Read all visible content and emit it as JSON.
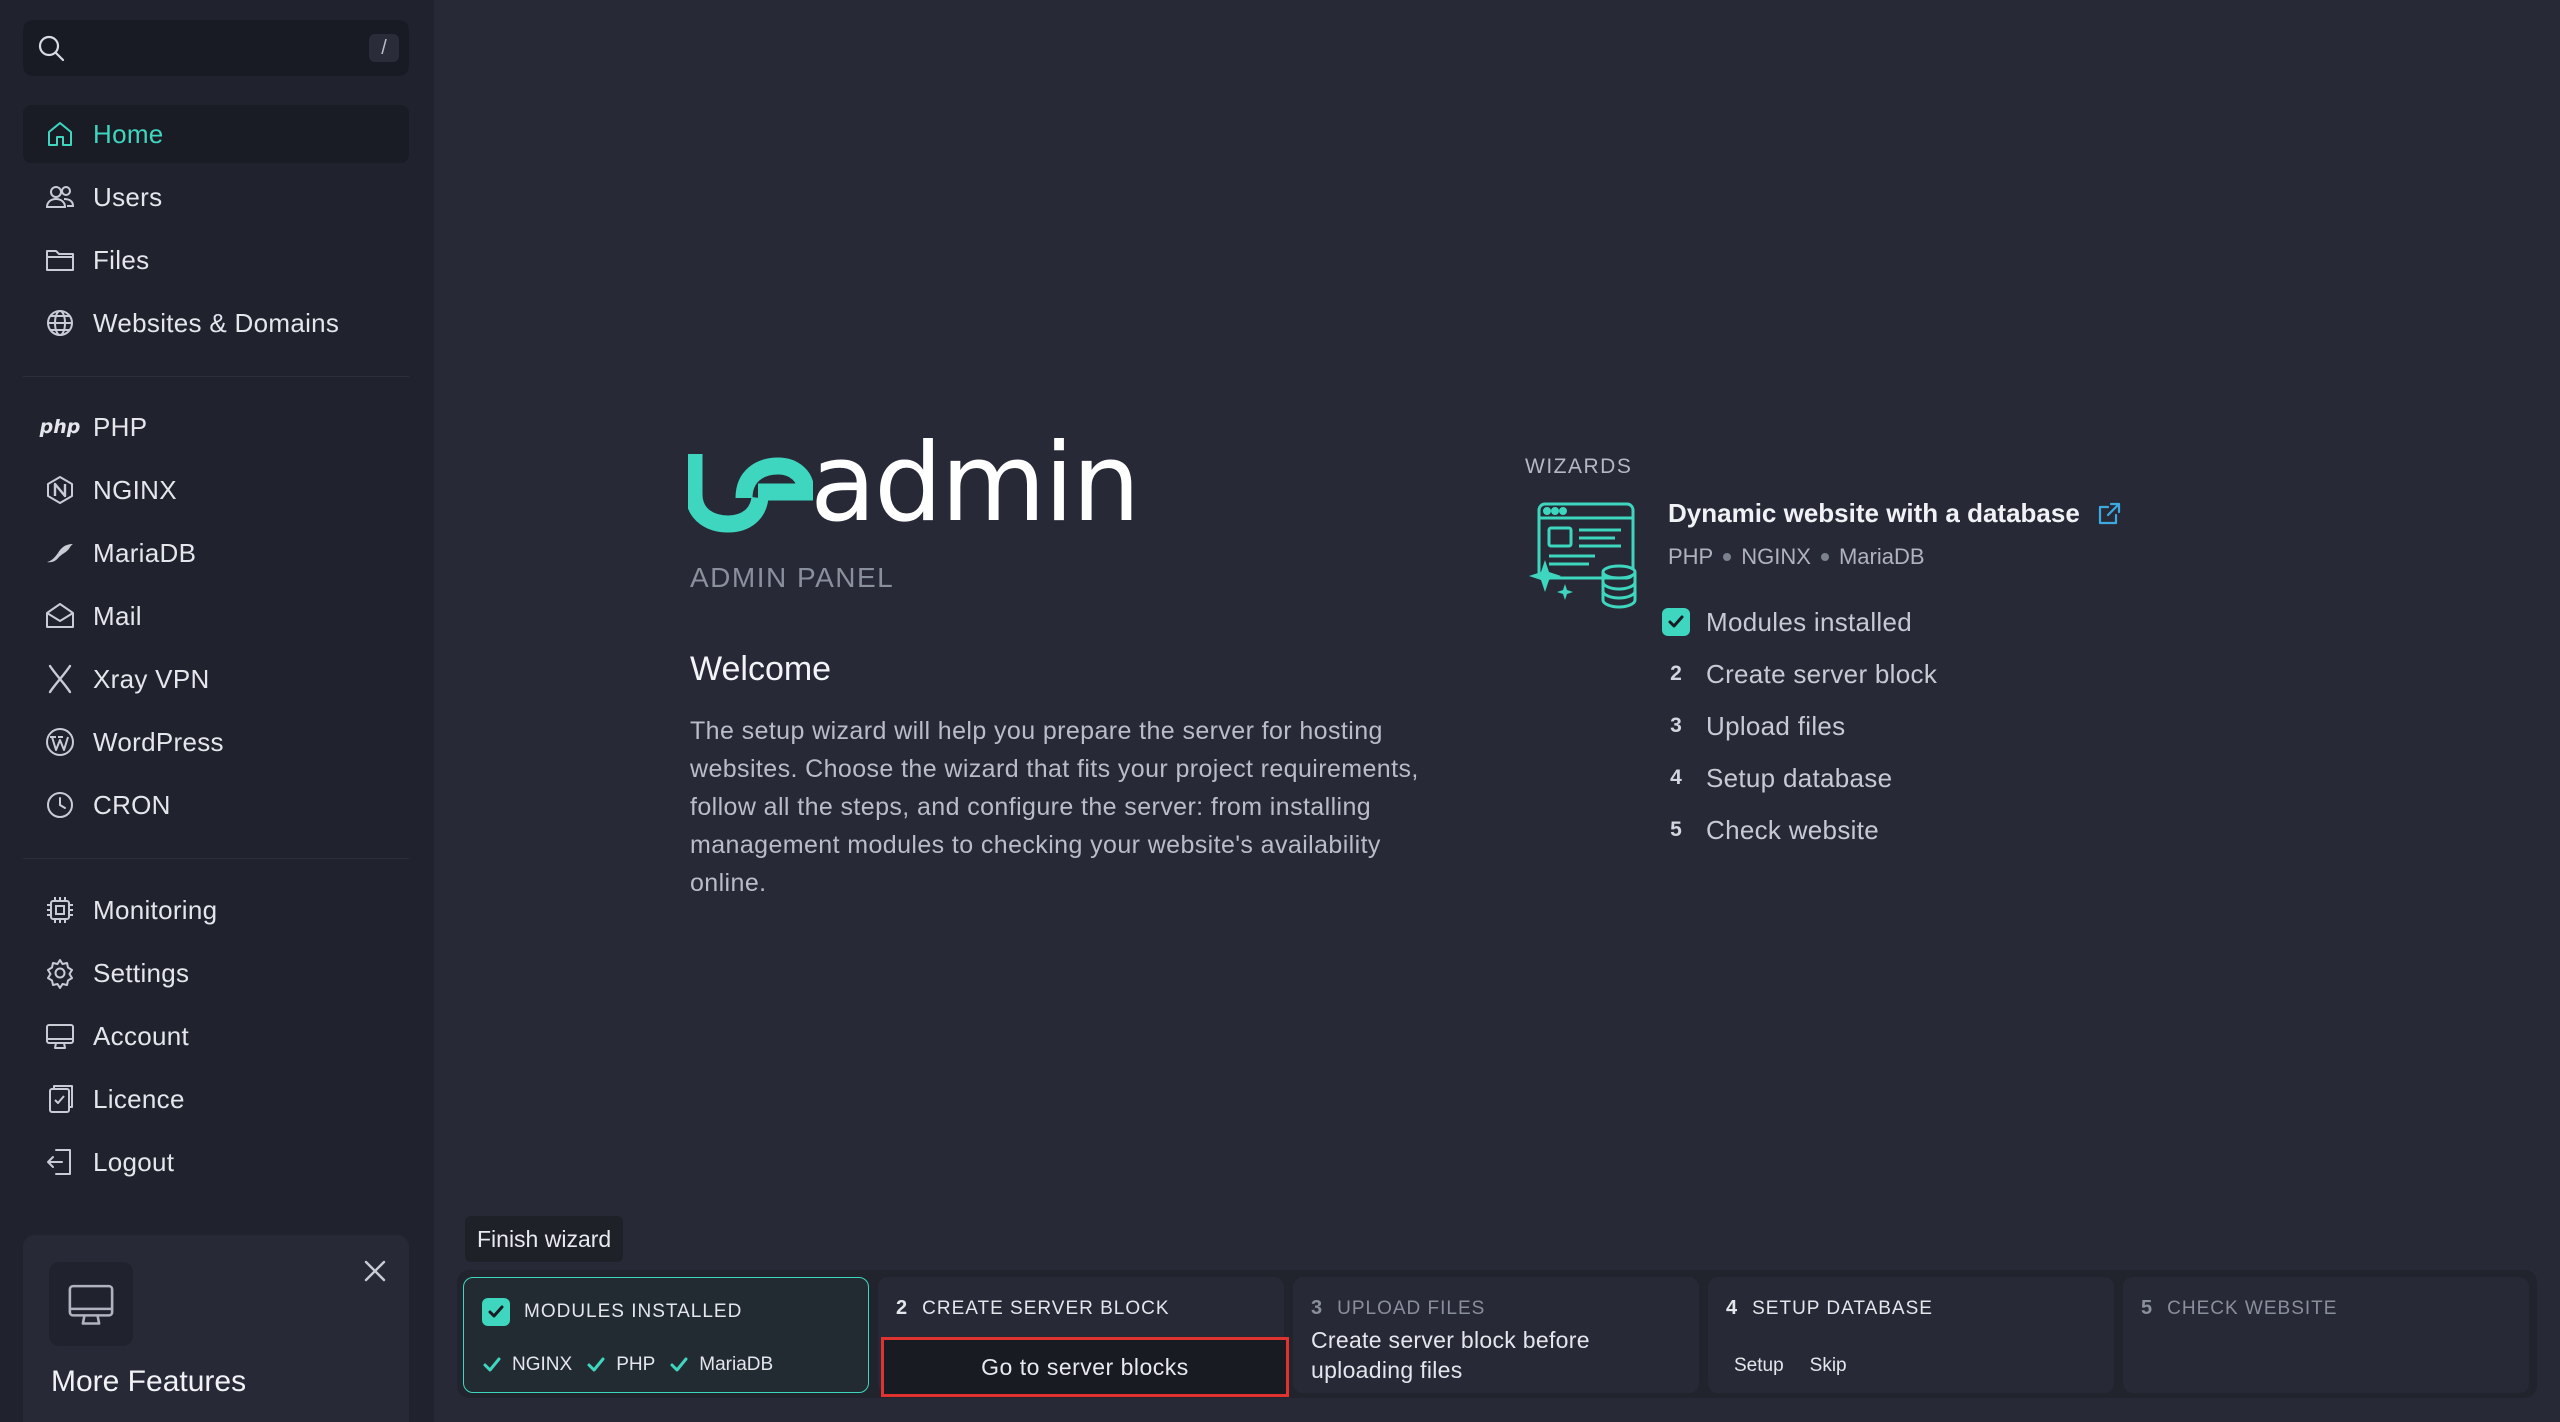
{
  "search": {
    "shortcut": "/"
  },
  "sidebar": {
    "groups": [
      [
        {
          "label": "Home",
          "icon": "home-icon",
          "active": true
        },
        {
          "label": "Users",
          "icon": "users-icon"
        },
        {
          "label": "Files",
          "icon": "folder-icon"
        },
        {
          "label": "Websites & Domains",
          "icon": "globe-icon"
        }
      ],
      [
        {
          "label": "PHP",
          "icon": "php-icon",
          "icon_text": "php"
        },
        {
          "label": "NGINX",
          "icon": "nginx-icon"
        },
        {
          "label": "MariaDB",
          "icon": "mariadb-icon"
        },
        {
          "label": "Mail",
          "icon": "mail-icon"
        },
        {
          "label": "Xray VPN",
          "icon": "xray-icon"
        },
        {
          "label": "WordPress",
          "icon": "wordpress-icon"
        },
        {
          "label": "CRON",
          "icon": "clock-icon"
        }
      ],
      [
        {
          "label": "Monitoring",
          "icon": "cpu-icon"
        },
        {
          "label": "Settings",
          "icon": "gear-icon"
        },
        {
          "label": "Account",
          "icon": "monitor-icon"
        },
        {
          "label": "Licence",
          "icon": "licence-icon"
        },
        {
          "label": "Logout",
          "icon": "logout-icon"
        }
      ]
    ],
    "promo": {
      "title": "More Features",
      "icon": "monitor-icon"
    }
  },
  "brand": {
    "logo_text": "beadmin",
    "subtitle": "ADMIN PANEL",
    "accent": "#3ed6bf"
  },
  "welcome": {
    "title": "Welcome",
    "text": "The setup wizard will help you prepare the server for hosting websites. Choose the wizard that fits your project requirements, follow all the steps, and configure the server: from installing management modules to checking your website's availability online."
  },
  "wizards": {
    "label": "WIZARDS",
    "title": "Dynamic website with a database",
    "stack": [
      "PHP",
      "NGINX",
      "MariaDB"
    ],
    "steps": [
      {
        "num": "",
        "label": "Modules installed",
        "done": true
      },
      {
        "num": "2",
        "label": "Create server block"
      },
      {
        "num": "3",
        "label": "Upload files"
      },
      {
        "num": "4",
        "label": "Setup database"
      },
      {
        "num": "5",
        "label": "Check website"
      }
    ]
  },
  "wizard_bar": {
    "finish_label": "Finish wizard",
    "cards": [
      {
        "num": "",
        "title": "MODULES INSTALLED",
        "modules": [
          "NGINX",
          "PHP",
          "MariaDB"
        ]
      },
      {
        "num": "2",
        "title": "CREATE SERVER BLOCK",
        "button": "Go to server blocks"
      },
      {
        "num": "3",
        "title": "UPLOAD FILES",
        "note": "Create server block before uploading files"
      },
      {
        "num": "4",
        "title": "SETUP DATABASE",
        "actions": [
          "Setup",
          "Skip"
        ]
      },
      {
        "num": "5",
        "title": "CHECK WEBSITE"
      }
    ]
  }
}
